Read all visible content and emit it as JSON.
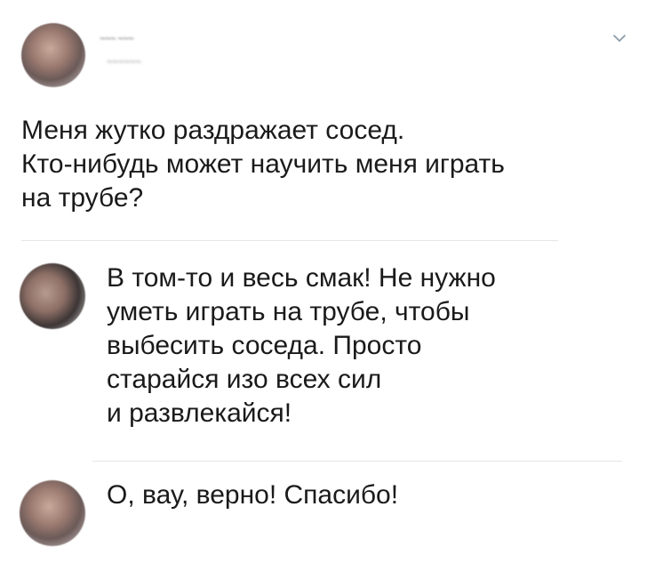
{
  "tweet": {
    "author_name": "~~~ ~~~",
    "author_handle": "~~~~~~",
    "text": "Меня жутко раздражает сосед.\nКто-нибудь может научить меня играть\nна трубе?",
    "menu_icon": "chevron-down-icon"
  },
  "replies": [
    {
      "text": "В том-то и весь смак! Не нужно\nуметь играть на трубе, чтобы\nвыбесить соседа. Просто\nстарайся изо всех сил\nи развлекайся!"
    },
    {
      "text": "О, вау, верно! Спасибо!"
    }
  ],
  "colors": {
    "background": "#ffffff",
    "text": "#1a1a1a",
    "divider": "#e6e6e6",
    "chevron": "#8899a6"
  }
}
